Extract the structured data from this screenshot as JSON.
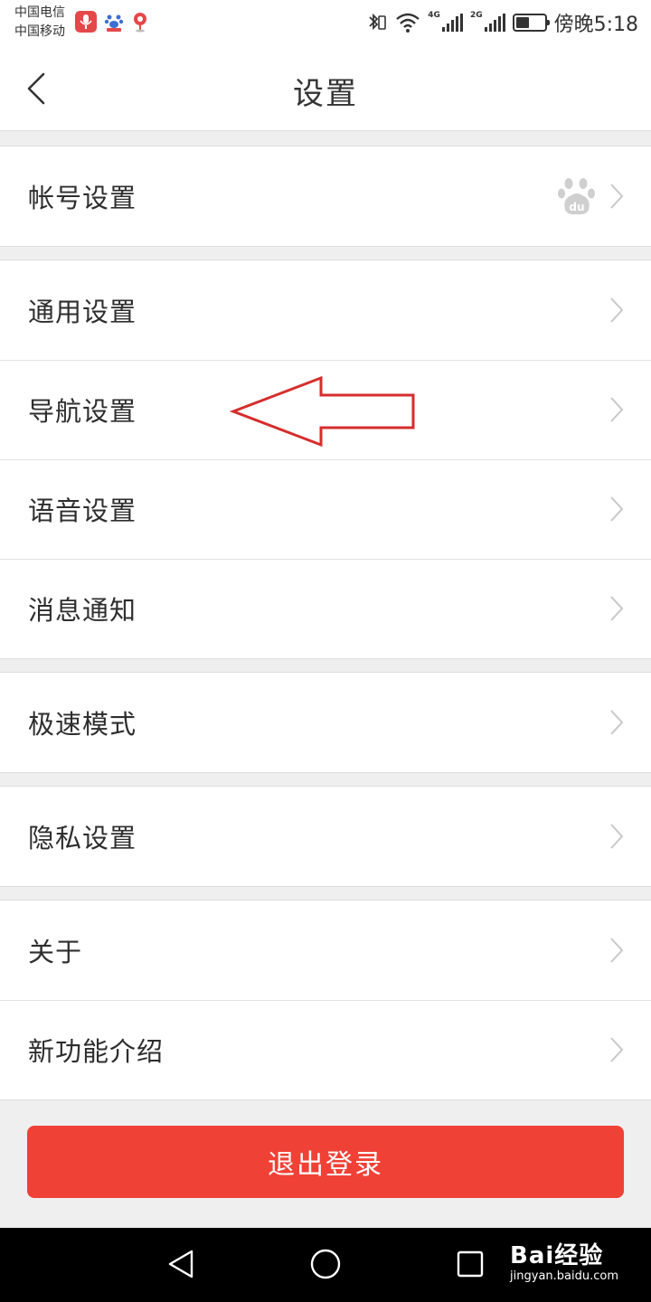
{
  "status_bar": {
    "carrier_1": "中国电信",
    "carrier_2": "中国移动",
    "net_1": "4G",
    "net_2": "2G",
    "time": "傍晚5:18"
  },
  "header": {
    "title": "设置"
  },
  "groups": [
    {
      "items": [
        {
          "label": "帐号设置"
        }
      ]
    },
    {
      "items": [
        {
          "label": "通用设置"
        },
        {
          "label": "导航设置"
        },
        {
          "label": "语音设置"
        },
        {
          "label": "消息通知"
        }
      ]
    },
    {
      "items": [
        {
          "label": "极速模式"
        }
      ]
    },
    {
      "items": [
        {
          "label": "隐私设置"
        }
      ]
    },
    {
      "items": [
        {
          "label": "关于"
        },
        {
          "label": "新功能介绍"
        }
      ]
    }
  ],
  "logout_label": "退出登录",
  "watermark": {
    "main": "Bai经验",
    "sub": "jingyan.baidu.com"
  },
  "colors": {
    "accent": "#f04136",
    "annotation": "#d62d2d",
    "background": "#efeff0"
  },
  "icons": [
    "back-icon",
    "chevron-right-icon",
    "baidu-paw-icon",
    "back-triangle-icon",
    "home-circle-icon",
    "recents-square-icon"
  ]
}
